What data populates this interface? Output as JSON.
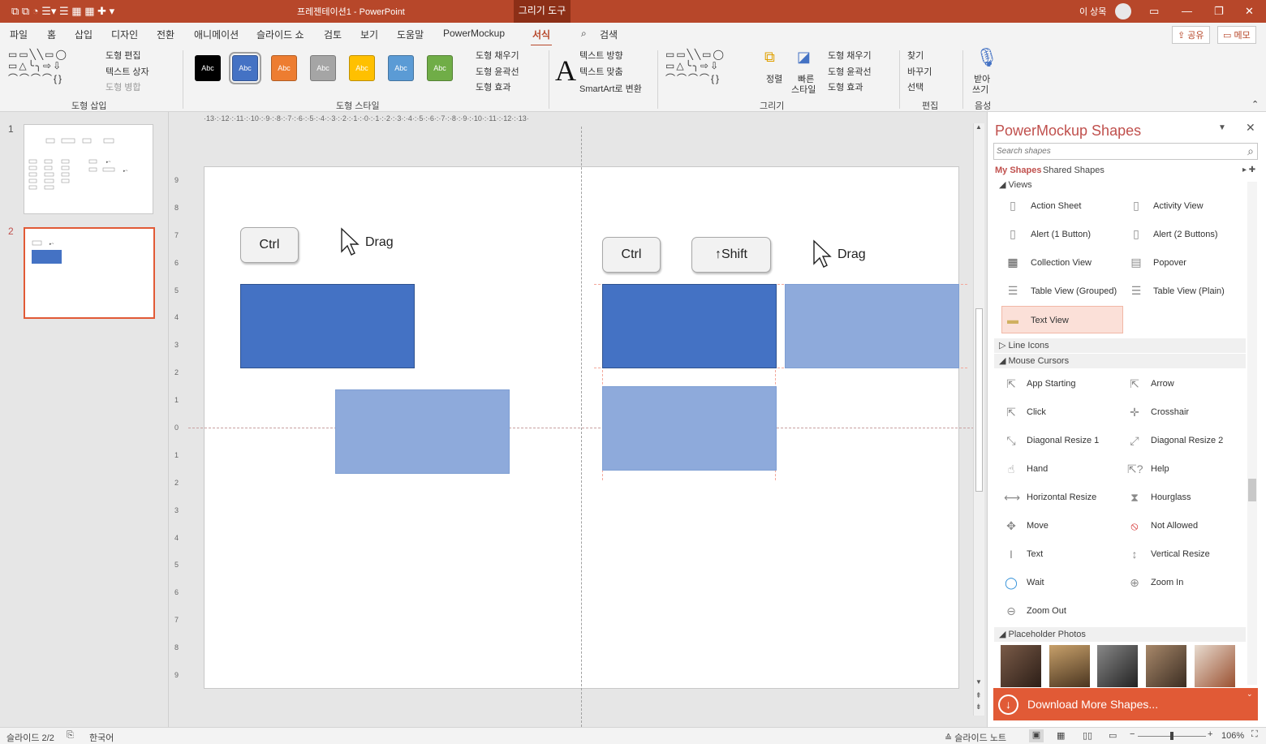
{
  "titlebar": {
    "doc_title": "프레젠테이션1  -  PowerPoint",
    "contextual_tab": "그리기 도구",
    "user_name": "이 상목",
    "qat_glyphs": "⧉  ⧉  ◔  ☰▾  ☰  ▦  ▦  ✚  ▾"
  },
  "tabs": [
    "파일",
    "홈",
    "삽입",
    "디자인",
    "전환",
    "애니메이션",
    "슬라이드 쇼",
    "검토",
    "보기",
    "도움말",
    "PowerMockup",
    "서식"
  ],
  "active_tab": "서식",
  "search_label": "검색",
  "share_label": "공유",
  "memo_label": "메모",
  "ribbon": {
    "insert_shapes": {
      "label": "도형 삽입",
      "edit_shape": "도형 편집",
      "text_box": "텍스트 상자",
      "merge_shapes": "도형 병합"
    },
    "shape_styles": {
      "label": "도형 스타일",
      "presets": [
        {
          "text": "Abc",
          "color": "#000000"
        },
        {
          "text": "Abc",
          "color": "#4472c4"
        },
        {
          "text": "Abc",
          "color": "#ed7d31"
        },
        {
          "text": "Abc",
          "color": "#a5a5a5"
        },
        {
          "text": "Abc",
          "color": "#ffc000"
        },
        {
          "text": "Abc",
          "color": "#5b9bd5"
        },
        {
          "text": "Abc",
          "color": "#70ad47"
        }
      ],
      "fill": "도형 채우기",
      "outline": "도형 윤곽선",
      "effects": "도형 효과"
    },
    "wordart": {
      "text_direction": "텍스트 방향",
      "text_align": "텍스트 맞춤",
      "smartart": "SmartArt로 변환"
    },
    "drawing": {
      "label": "그리기",
      "arrange": "정렬",
      "quick_styles_1": "빠른",
      "quick_styles_2": "스타일",
      "fill": "도형 채우기",
      "outline": "도형 윤곽선",
      "effects": "도형 효과"
    },
    "editing": {
      "label": "편집",
      "find": "찾기",
      "replace": "바꾸기",
      "select": "선택"
    },
    "voice": {
      "label": "음성",
      "dictate_1": "받아",
      "dictate_2": "쓰기"
    }
  },
  "thumbnails": {
    "numbers": [
      "1",
      "2"
    ]
  },
  "slide": {
    "left_group": {
      "key": "Ctrl",
      "drag": "Drag"
    },
    "right_group": {
      "key1": "Ctrl",
      "key2": "↑Shift",
      "drag": "Drag"
    }
  },
  "pane": {
    "title": "PowerMockup Shapes",
    "search_placeholder": "Search shapes",
    "my_shapes": "My Shapes",
    "shared_shapes": "Shared Shapes",
    "sections": {
      "views": "Views",
      "line_icons": "Line Icons",
      "mouse_cursors": "Mouse Cursors",
      "placeholder_photos": "Placeholder Photos"
    },
    "views": [
      "Action Sheet",
      "Activity View",
      "Alert (1 Button)",
      "Alert (2 Buttons)",
      "Collection View",
      "Popover",
      "Table View (Grouped)",
      "Table View (Plain)",
      "Text View"
    ],
    "cursors": [
      "App Starting",
      "Arrow",
      "Click",
      "Crosshair",
      "Diagonal Resize 1",
      "Diagonal Resize 2",
      "Hand",
      "Help",
      "Horizontal Resize",
      "Hourglass",
      "Move",
      "Not Allowed",
      "Text",
      "Vertical Resize",
      "Wait",
      "Zoom In",
      "Zoom Out"
    ],
    "download": "Download More Shapes..."
  },
  "status": {
    "slide_indicator": "슬라이드 2/2",
    "language": "한국어",
    "notes": "슬라이드 노트",
    "zoom": "106%"
  },
  "ruler": {
    "h": "·13·:·12·:·11·:·10·:·9·:·8·:·7·:·6·:·5·:·4·:·3·:·2·:·1·:·0·:·1·:·2·:·3·:·4·:·5·:·6·:·7·:·8·:·9·:·10·:·11·:·12·:·13·",
    "v": [
      "9",
      "8",
      "7",
      "6",
      "5",
      "4",
      "3",
      "2",
      "1",
      "0",
      "1",
      "2",
      "3",
      "4",
      "5",
      "6",
      "7",
      "8",
      "9"
    ]
  },
  "colors": {
    "accent": "#b7472a",
    "shape_dark": "#4472c4",
    "shape_light": "#8eaadb",
    "pane_title": "#c0504d",
    "download_bar": "#e15a36"
  }
}
